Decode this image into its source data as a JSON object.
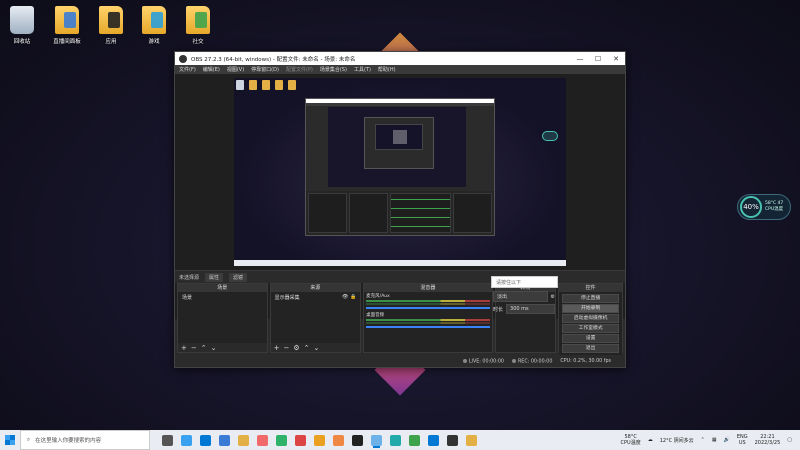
{
  "desktop": {
    "icons": [
      {
        "label": "回收站",
        "kind": "bin"
      },
      {
        "label": "直播间面板",
        "kind": "folder",
        "inner": "#3a7bd5"
      },
      {
        "label": "应用",
        "kind": "folder",
        "inner": "#222"
      },
      {
        "label": "游戏",
        "kind": "folder",
        "inner": "#2a9fd8"
      },
      {
        "label": "社交",
        "kind": "folder",
        "inner": "#3fa34d"
      }
    ],
    "cpu_widget": {
      "percent": "40%",
      "line1": "58°C 47",
      "line2": "CPU温度"
    }
  },
  "obs": {
    "title": "OBS 27.2.3 (64-bit, windows) - 配置文件: 未命名 - 场景: 未命名",
    "menu": [
      "文件(F)",
      "编辑(E)",
      "视图(V)",
      "停靠窗口(D)",
      "配置文件(P)",
      "场景集合(S)",
      "工具(T)",
      "帮助(H)"
    ],
    "context": {
      "no_source": "未选择源",
      "properties": "属性",
      "filters": "滤镜"
    },
    "docks": {
      "scenes": {
        "title": "场景",
        "items": [
          "场景"
        ]
      },
      "sources": {
        "title": "来源",
        "items": [
          "显示器采集"
        ]
      },
      "mixer": {
        "title": "混音器",
        "tracks": [
          "桌面音频",
          "麦克风/Aux"
        ]
      },
      "transitions": {
        "title": "转场",
        "popup": "请按住以下",
        "type": "淡出",
        "duration_label": "时长",
        "duration": "300 ms"
      },
      "controls": {
        "title": "控件",
        "buttons": [
          "停止直播",
          "开始录制",
          "启动虚拟摄像机",
          "工作室模式",
          "设置",
          "退出"
        ]
      }
    },
    "status": {
      "live": "LIVE: 00:00:00",
      "rec": "REC: 00:00:00",
      "cpu": "CPU: 0.2%, 30.00 fps"
    }
  },
  "taskbar": {
    "search_placeholder": "在这里输入你要搜索的内容",
    "apps": [
      "#555",
      "#3aa0f0",
      "#0078d4",
      "#3a7bd5",
      "#e3b046",
      "#f06a6a",
      "#2fb36a",
      "#d44",
      "#eaa020",
      "#e84",
      "#222",
      "#6cb2e8",
      "#2aa",
      "#3fa34d",
      "#0078d4",
      "#333",
      "#e3b046"
    ],
    "temp": {
      "value": "58°C",
      "label": "CPU温度"
    },
    "weather": "12°C 阴间多云",
    "lang": {
      "line1": "ENG",
      "line2": "US"
    },
    "clock": {
      "time": "22:21",
      "date": "2022/3/25"
    }
  }
}
